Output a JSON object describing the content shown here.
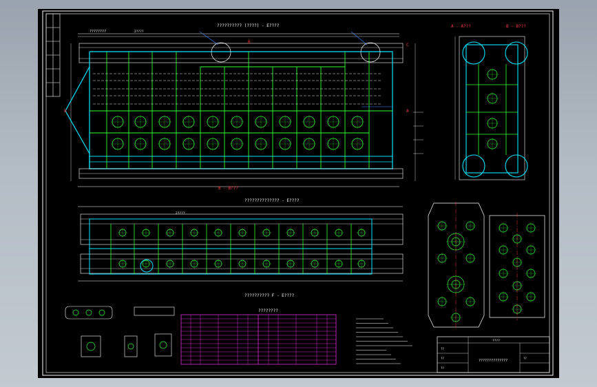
{
  "drawing": {
    "background": "#000000",
    "frame_color": "#ffffff",
    "main_line_color": "#00e5ff",
    "grid_line_color": "#33ff33",
    "dim_color": "#ffffff",
    "table_color": "#ff33ff",
    "callout_color": "#3a8bff",
    "accent_color": "#ff3b3b",
    "annotation_color": "#ffff33",
    "views": {
      "top_title": "?????????? (????) - E????",
      "front_title": "?????????????? - E????",
      "bottom_title": "?????????? F - E????",
      "section_a": "A - A???",
      "section_b": "B - B???",
      "section_mark": "B - B???",
      "parts_table_title": "????????"
    },
    "labels": {
      "left_heading": "????????",
      "top_dim": "2????",
      "top_dim2": "2????",
      "side_b": "B",
      "side_a": "A",
      "side_c": "C"
    },
    "title_block": {
      "drawing_title": "??????????????",
      "code": "????",
      "row_labels": [
        "??",
        "??",
        "??",
        "??"
      ]
    }
  }
}
